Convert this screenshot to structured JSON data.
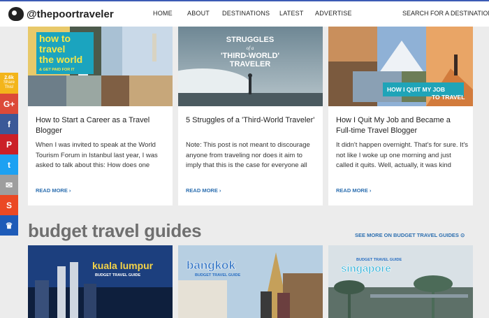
{
  "brand": {
    "name": "@thepoortraveler"
  },
  "nav": {
    "home": "HOME",
    "about": "ABOUT",
    "destinations": "DESTINATIONS",
    "latest": "LATEST",
    "advertise": "ADVERTISE"
  },
  "search": {
    "label": "SEARCH FOR A DESTINATION"
  },
  "share": {
    "count": "2.6k",
    "label": "Share This!",
    "google": "G+",
    "facebook": "f",
    "pinterest": "P",
    "twitter": "t",
    "email": "✉",
    "stumble": "S",
    "more": "♛"
  },
  "posts": [
    {
      "title": "How to Start a Career as a Travel Blogger",
      "excerpt": "When I was invited to speak at the World Tourism Forum in Istanbul last year, I was asked to talk about this: How does one",
      "more": "READ MORE ›",
      "overlay": [
        "how to",
        "travel",
        "the world",
        "& GET PAID FOR IT"
      ]
    },
    {
      "title": "5 Struggles of a 'Third-World Traveler'",
      "excerpt": "Note: This post is not meant to discourage anyone from traveling nor does it aim to imply that this is the case for everyone all",
      "more": "READ MORE ›",
      "overlay": [
        "STRUGGLES",
        "of a",
        "'THIRD-WORLD'",
        "TRAVELER"
      ]
    },
    {
      "title": "How I Quit My Job and Became a Full-time Travel Blogger",
      "excerpt": "It didn't happen overnight. That's for sure. It's not like I woke up one morning and just called it quits. Well, actually, it was kind",
      "more": "READ MORE ›",
      "overlay": [
        "HOW I QUIT MY JOB",
        "TO TRAVEL"
      ]
    }
  ],
  "section": {
    "title": "budget travel guides",
    "see_more": "SEE MORE ON BUDGET TRAVEL GUIDES ⊙"
  },
  "guides": [
    {
      "city": "kuala lumpur",
      "sub": "BUDGET TRAVEL GUIDE"
    },
    {
      "city": "bangkok",
      "sub": "BUDGET TRAVEL GUIDE"
    },
    {
      "city": "singapore",
      "sub": "BUDGET TRAVEL GUIDE"
    }
  ],
  "colors": {
    "accent": "#2d6fb0",
    "share_count": "#f3b51b",
    "google": "#dc4a38",
    "facebook": "#3b5998",
    "pinterest": "#cb2027",
    "twitter": "#1da1f2",
    "email": "#9e9e9e",
    "stumble": "#eb4924",
    "more": "#1e5bb8"
  }
}
